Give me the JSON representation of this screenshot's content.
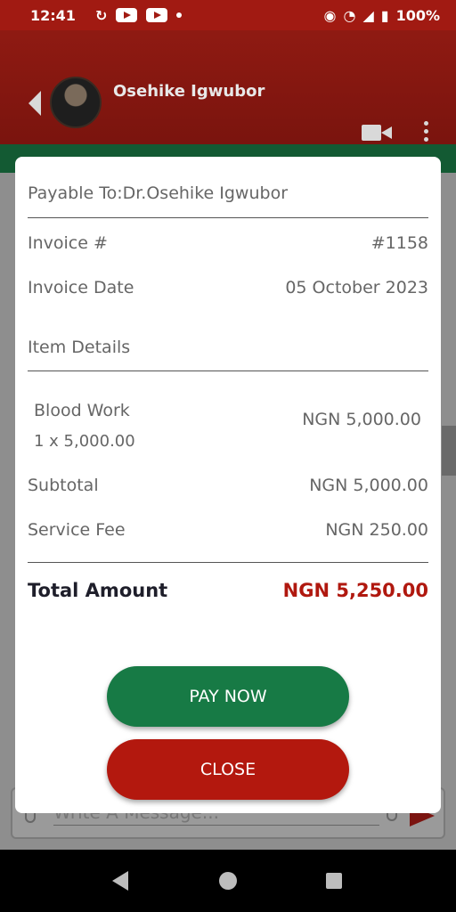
{
  "status_bar": {
    "time": "12:41",
    "battery": "100%",
    "icons": [
      "sync-icon",
      "youtube-icon",
      "youtube-icon",
      "dot-icon",
      "location-icon",
      "wifi-icon",
      "signal-icon",
      "battery-icon"
    ]
  },
  "header": {
    "contact_name": "Osehike Igwubor"
  },
  "composer": {
    "placeholder": "Write A Message..."
  },
  "invoice": {
    "payable_to": "Payable To:Dr.Osehike Igwubor",
    "invoice_number_label": "Invoice #",
    "invoice_number": "#1158",
    "invoice_date_label": "Invoice Date",
    "invoice_date": "05 October 2023",
    "item_details_label": "Item Details",
    "items": [
      {
        "name": "Blood Work",
        "qty": "1 x 5,000.00",
        "price": "NGN 5,000.00"
      }
    ],
    "subtotal_label": "Subtotal",
    "subtotal": "NGN 5,000.00",
    "service_fee_label": "Service Fee",
    "service_fee": "NGN 250.00",
    "total_label": "Total Amount",
    "total": "NGN 5,250.00",
    "pay_label": "PAY NOW",
    "close_label": "CLOSE"
  },
  "colors": {
    "brand_red": "#a11a12",
    "brand_green": "#177a45",
    "total_red": "#b0180f"
  }
}
